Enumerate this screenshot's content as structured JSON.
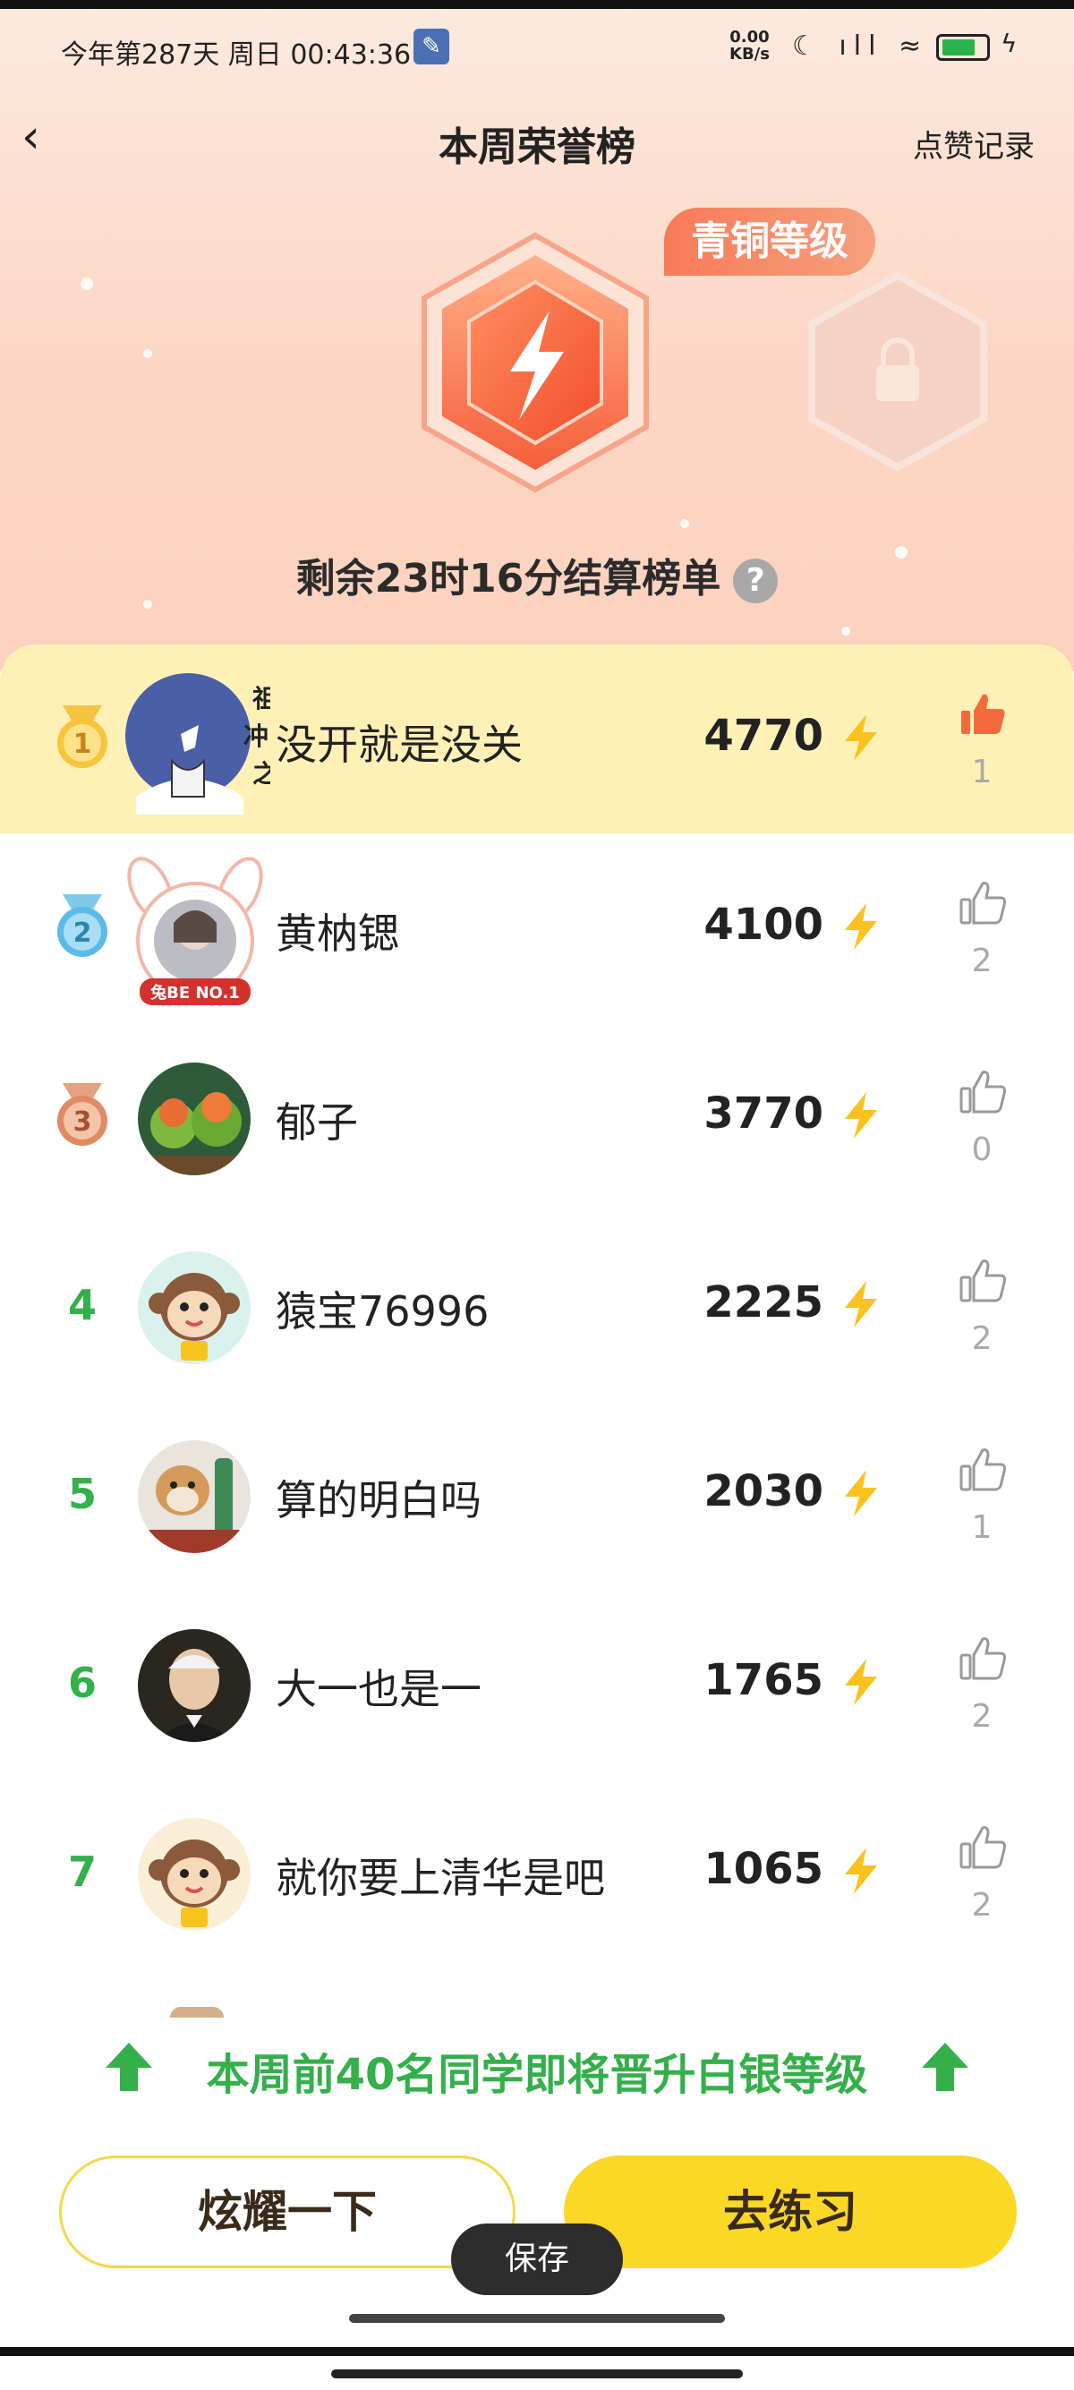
{
  "status_bar": {
    "left_text": "今年第287天 周日 00:43:36",
    "net_speed_value": "0.00",
    "net_speed_unit": "KB/s",
    "right_icons": "☾ ıll ≈"
  },
  "nav": {
    "back_glyph": "‹",
    "title": "本周荣誉榜",
    "likes_record_label": "点赞记录"
  },
  "level": {
    "current_level_tag": "青铜等级",
    "countdown_text": "剩余23时16分结算榜单",
    "help_glyph": "?"
  },
  "leaderboard": [
    {
      "rank": 1,
      "name": "没开就是没关",
      "score": "4770",
      "likes": "1",
      "liked": true
    },
    {
      "rank": 2,
      "name": "黄枘锶",
      "score": "4100",
      "likes": "2",
      "liked": false
    },
    {
      "rank": 3,
      "name": "郁子",
      "score": "3770",
      "likes": "0",
      "liked": false
    },
    {
      "rank": 4,
      "name": "猿宝76996",
      "score": "2225",
      "likes": "2",
      "liked": false
    },
    {
      "rank": 5,
      "name": "算的明白吗",
      "score": "2030",
      "likes": "1",
      "liked": false
    },
    {
      "rank": 6,
      "name": "大一也是一",
      "score": "1765",
      "likes": "2",
      "liked": false
    },
    {
      "rank": 7,
      "name": "就你要上清华是吧",
      "score": "1065",
      "likes": "2",
      "liked": false
    }
  ],
  "avatar_decoration_text": {
    "rank1_calligraphy": "祖冲之",
    "rank2_frame": "兔BE NO.1"
  },
  "promo_text": "本周前40名同学即将晋升白银等级",
  "buttons": {
    "show_off": "炫耀一下",
    "go_practice": "去练习"
  },
  "toast": "保存",
  "colors": {
    "accent_green": "#33b04a",
    "primary_yellow": "#fbd825",
    "bronze_orange": "#f87a58",
    "highlight_row": "#fff1b6"
  }
}
